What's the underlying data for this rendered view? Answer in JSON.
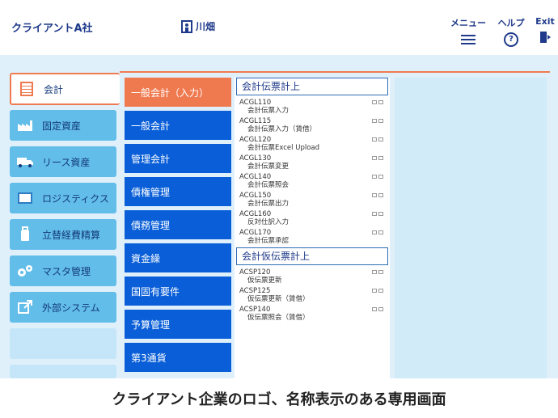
{
  "header": {
    "company": "クライアントA社",
    "user": "川畑",
    "menu_label": "メニュー",
    "help_label": "ヘルプ",
    "exit_label": "Exit"
  },
  "sidebar": {
    "items": [
      {
        "label": "会計",
        "icon": "calculator-icon"
      },
      {
        "label": "固定資産",
        "icon": "factory-icon"
      },
      {
        "label": "リース資産",
        "icon": "truck-icon"
      },
      {
        "label": "ロジスティクス",
        "icon": "box-icon"
      },
      {
        "label": "立替経費精算",
        "icon": "luggage-icon"
      },
      {
        "label": "マスタ管理",
        "icon": "gears-icon"
      },
      {
        "label": "外部システム",
        "icon": "external-link-icon"
      }
    ]
  },
  "categories": [
    "一般会計（入力）",
    "一般会計",
    "管理会計",
    "債権管理",
    "債務管理",
    "資金繰",
    "国固有要件",
    "予算管理",
    "第3通貨"
  ],
  "groups": [
    {
      "title": "会計伝票計上",
      "entries": [
        {
          "code": "ACGL110",
          "name": "会計伝票入力"
        },
        {
          "code": "ACGL115",
          "name": "会計伝票入力（賃借）"
        },
        {
          "code": "ACGL120",
          "name": "会計伝票Excel Upload"
        },
        {
          "code": "ACGL130",
          "name": "会計伝票変更"
        },
        {
          "code": "ACGL140",
          "name": "会計伝票照会"
        },
        {
          "code": "ACGL150",
          "name": "会計伝票出力"
        },
        {
          "code": "ACGL160",
          "name": "反対仕訳入力"
        },
        {
          "code": "ACGL170",
          "name": "会計伝票承認"
        }
      ]
    },
    {
      "title": "会計仮伝票計上",
      "entries": [
        {
          "code": "ACSP120",
          "name": "仮伝票更新"
        },
        {
          "code": "ACSP125",
          "name": "仮伝票更新（賃借）"
        },
        {
          "code": "ACSP140",
          "name": "仮伝票照会（賃借）"
        }
      ]
    }
  ],
  "caption": "クライアント企業のロゴ、名称表示のある専用画面",
  "colors": {
    "accent": "#f07a50",
    "primary": "#0a5fd8",
    "sidebar": "#63bde9",
    "background": "#dff0fb"
  }
}
